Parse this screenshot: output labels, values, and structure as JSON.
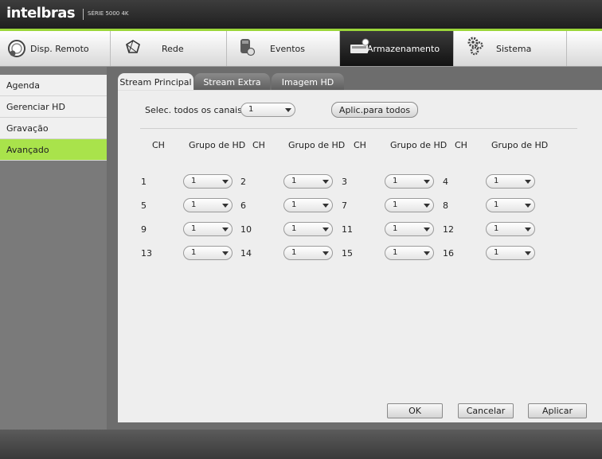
{
  "brand": {
    "name": "intelbras",
    "series": "SÉRIE 5000 4K"
  },
  "nav": {
    "items": [
      {
        "label": "Disp. Remoto",
        "icon": "remote-device-icon"
      },
      {
        "label": "Rede",
        "icon": "network-icon"
      },
      {
        "label": "Eventos",
        "icon": "events-icon"
      },
      {
        "label": "Armazenamento",
        "icon": "storage-icon",
        "active": true
      },
      {
        "label": "Sistema",
        "icon": "system-gears-icon"
      }
    ]
  },
  "sidebar": {
    "items": [
      {
        "label": "Agenda"
      },
      {
        "label": "Gerenciar HD"
      },
      {
        "label": "Gravação"
      },
      {
        "label": "Avançado",
        "active": true
      }
    ]
  },
  "tabs": [
    {
      "label": "Stream Principal",
      "active": true
    },
    {
      "label": "Stream Extra"
    },
    {
      "label": "Imagem HD"
    }
  ],
  "select_all": {
    "label": "Selec. todos os canais",
    "value": "1",
    "apply_button": "Aplic.para todos"
  },
  "grid": {
    "headers": {
      "ch": "CH",
      "group": "Grupo de HD"
    },
    "rows": [
      [
        {
          "ch": "1",
          "hd": "1"
        },
        {
          "ch": "2",
          "hd": "1"
        },
        {
          "ch": "3",
          "hd": "1"
        },
        {
          "ch": "4",
          "hd": "1"
        }
      ],
      [
        {
          "ch": "5",
          "hd": "1"
        },
        {
          "ch": "6",
          "hd": "1"
        },
        {
          "ch": "7",
          "hd": "1"
        },
        {
          "ch": "8",
          "hd": "1"
        }
      ],
      [
        {
          "ch": "9",
          "hd": "1"
        },
        {
          "ch": "10",
          "hd": "1"
        },
        {
          "ch": "11",
          "hd": "1"
        },
        {
          "ch": "12",
          "hd": "1"
        }
      ],
      [
        {
          "ch": "13",
          "hd": "1"
        },
        {
          "ch": "14",
          "hd": "1"
        },
        {
          "ch": "15",
          "hd": "1"
        },
        {
          "ch": "16",
          "hd": "1"
        }
      ]
    ]
  },
  "footer": {
    "ok": "OK",
    "cancel": "Cancelar",
    "apply": "Aplicar"
  },
  "colors": {
    "accent": "#a9e34b",
    "nav_active": "#1f1f1f",
    "background": "#6d6d6d"
  }
}
